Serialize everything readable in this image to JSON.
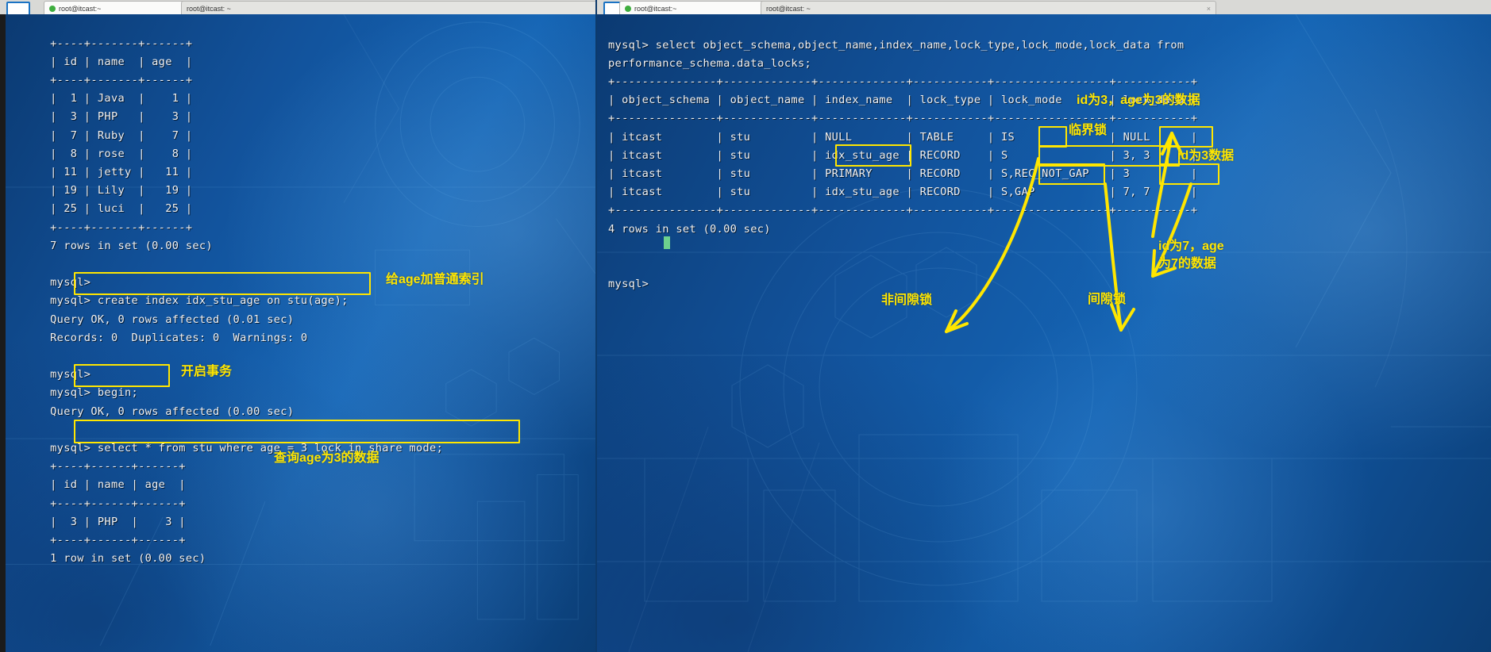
{
  "windows": {
    "left": {
      "tabs": [
        {
          "label": "root@itcast:~",
          "icon": "terminal-tab-icon"
        },
        {
          "label": "root@itcast: ~",
          "icon": "terminal-tab-icon"
        }
      ],
      "terminal_text": "    +----+-------+------+\n    | id | name  | age  |\n    +----+-------+------+\n    |  1 | Java  |    1 |\n    |  3 | PHP   |    3 |\n    |  7 | Ruby  |    7 |\n    |  8 | rose  |    8 |\n    | 11 | jetty |   11 |\n    | 19 | Lily  |   19 |\n    | 25 | luci  |   25 |\n    +----+-------+------+\n    7 rows in set (0.00 sec)\n\n    mysql>\n    mysql> create index idx_stu_age on stu(age);\n    Query OK, 0 rows affected (0.01 sec)\n    Records: 0  Duplicates: 0  Warnings: 0\n\n    mysql>\n    mysql> begin;\n    Query OK, 0 rows affected (0.00 sec)\n\n    mysql> select * from stu where age = 3 lock in share mode;\n    +----+------+------+\n    | id | name | age  |\n    +----+------+------+\n    |  3 | PHP  |    3 |\n    +----+------+------+\n    1 row in set (0.00 sec)"
    },
    "right": {
      "tabs": [
        {
          "label": "root@itcast:~",
          "icon": "terminal-tab-icon"
        },
        {
          "label": "root@itcast: ~",
          "icon": "terminal-tab-icon"
        }
      ],
      "terminal_text": "mysql> select object_schema,object_name,index_name,lock_type,lock_mode,lock_data from\nperformance_schema.data_locks;\n+---------------+-------------+-------------+-----------+-----------------+-----------+\n| object_schema | object_name | index_name  | lock_type | lock_mode       | lock_data |\n+---------------+-------------+-------------+-----------+-----------------+-----------+\n| itcast        | stu         | NULL        | TABLE     | IS              | NULL      |\n| itcast        | stu         | idx_stu_age | RECORD    | S               | 3, 3      |\n| itcast        | stu         | PRIMARY     | RECORD    | S,REC_NOT_GAP   | 3         |\n| itcast        | stu         | idx_stu_age | RECORD    | S,GAP           | 7, 7      |\n+---------------+-------------+-------------+-----------+-----------------+-----------+\n4 rows in set (0.00 sec)\n\n\nmysql>"
    }
  },
  "left_table": {
    "columns": [
      "id",
      "name",
      "age"
    ],
    "rows": [
      [
        "1",
        "Java",
        "1"
      ],
      [
        "3",
        "PHP",
        "3"
      ],
      [
        "7",
        "Ruby",
        "7"
      ],
      [
        "8",
        "rose",
        "8"
      ],
      [
        "11",
        "jetty",
        "11"
      ],
      [
        "19",
        "Lily",
        "19"
      ],
      [
        "25",
        "luci",
        "25"
      ]
    ],
    "footer": "7 rows in set (0.00 sec)"
  },
  "left_result_table": {
    "columns": [
      "id",
      "name",
      "age"
    ],
    "rows": [
      [
        "3",
        "PHP",
        "3"
      ]
    ],
    "footer": "1 row in set (0.00 sec)"
  },
  "locks_table": {
    "columns": [
      "object_schema",
      "object_name",
      "index_name",
      "lock_type",
      "lock_mode",
      "lock_data"
    ],
    "rows": [
      [
        "itcast",
        "stu",
        "NULL",
        "TABLE",
        "IS",
        "NULL"
      ],
      [
        "itcast",
        "stu",
        "idx_stu_age",
        "RECORD",
        "S",
        "3, 3"
      ],
      [
        "itcast",
        "stu",
        "PRIMARY",
        "RECORD",
        "S,REC_NOT_GAP",
        "3"
      ],
      [
        "itcast",
        "stu",
        "idx_stu_age",
        "RECORD",
        "S,GAP",
        "7, 7"
      ]
    ],
    "footer": "4 rows in set (0.00 sec)"
  },
  "commands": {
    "create_index": "create index idx_stu_age on stu(age);",
    "begin": "begin;",
    "select_lock": "select * from stu where age = 3 lock in share mode;",
    "data_locks_query": "select object_schema,object_name,index_name,lock_type,lock_mode,lock_data from performance_schema.data_locks;"
  },
  "annotations": {
    "create_index_note": "给age加普通索引",
    "begin_note": "开启事务",
    "select_note": "查询age为3的数据",
    "id3_age3_note": "id为3，age为3的数据",
    "critical_lock_note": "临界锁",
    "id3_note": "id为3数据",
    "non_gap_lock_note": "非间隙锁",
    "gap_lock_note": "间隙锁",
    "id7_age7_note": "id为7，age\n为7的数据"
  },
  "colors": {
    "highlight": "#ffe600",
    "terminal_text": "#f2f2f2",
    "background": "#12529b",
    "cursor": "#78e08f"
  }
}
